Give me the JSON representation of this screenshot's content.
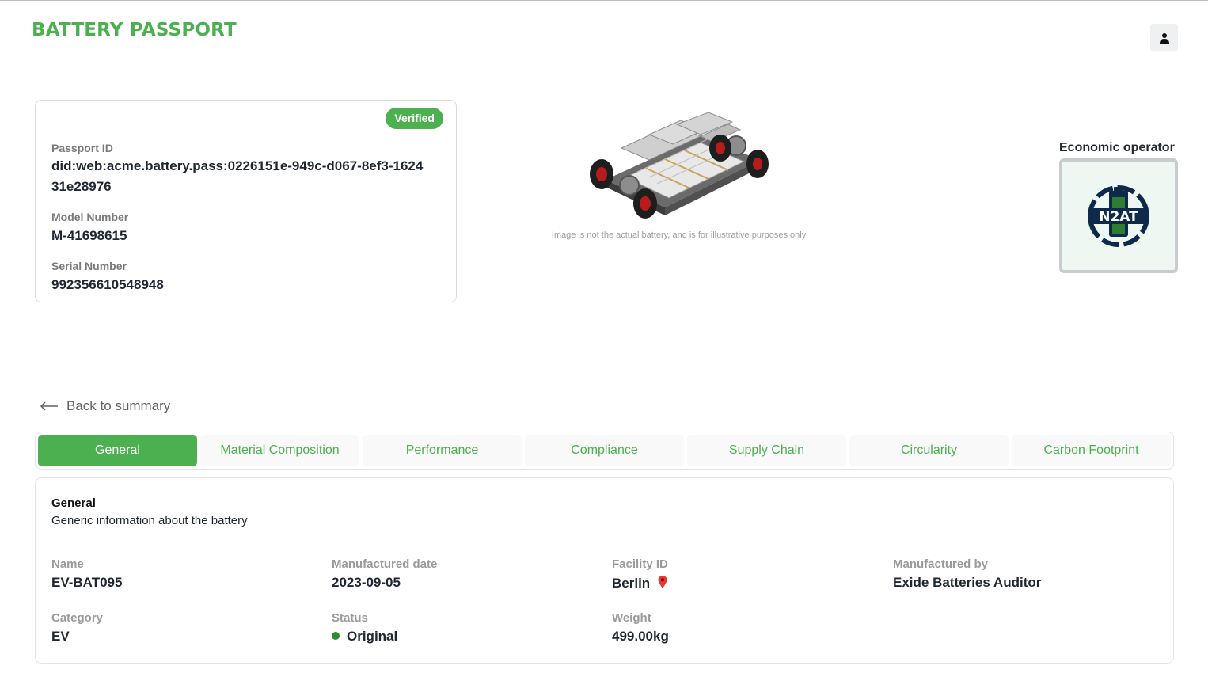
{
  "header": {
    "brand": "BATTERY PASSPORT",
    "user_icon": "user-icon"
  },
  "passport": {
    "badge": "Verified",
    "passport_id_label": "Passport ID",
    "passport_id": "did:web:acme.battery.pass:0226151e-949c-d067-8ef3-162431e28976",
    "model_label": "Model Number",
    "model": "M-41698615",
    "serial_label": "Serial Number",
    "serial": "992356610548948"
  },
  "illustration": {
    "caption": "Image is not the actual battery, and is for illustrative purposes only"
  },
  "economic_operator": {
    "title": "Economic operator",
    "logo_text": "N2AT"
  },
  "nav": {
    "back_label": "Back to summary"
  },
  "tabs": [
    {
      "label": "General",
      "active": true
    },
    {
      "label": "Material Composition",
      "active": false
    },
    {
      "label": "Performance",
      "active": false
    },
    {
      "label": "Compliance",
      "active": false
    },
    {
      "label": "Supply Chain",
      "active": false
    },
    {
      "label": "Circularity",
      "active": false
    },
    {
      "label": "Carbon Footprint",
      "active": false
    }
  ],
  "general": {
    "title": "General",
    "subtitle": "Generic information about the battery",
    "fields": {
      "name_label": "Name",
      "name": "EV-BAT095",
      "date_label": "Manufactured date",
      "date": "2023-09-05",
      "facility_label": "Facility ID",
      "facility": "Berlin",
      "manufacturer_label": "Manufactured by",
      "manufacturer": "Exide Batteries Auditor",
      "category_label": "Category",
      "category": "EV",
      "status_label": "Status",
      "status": "Original",
      "weight_label": "Weight",
      "weight": "499.00kg"
    }
  },
  "colors": {
    "brand_green": "#4caf50",
    "status_green": "#2e8b2e",
    "pin_red": "#e53935"
  }
}
